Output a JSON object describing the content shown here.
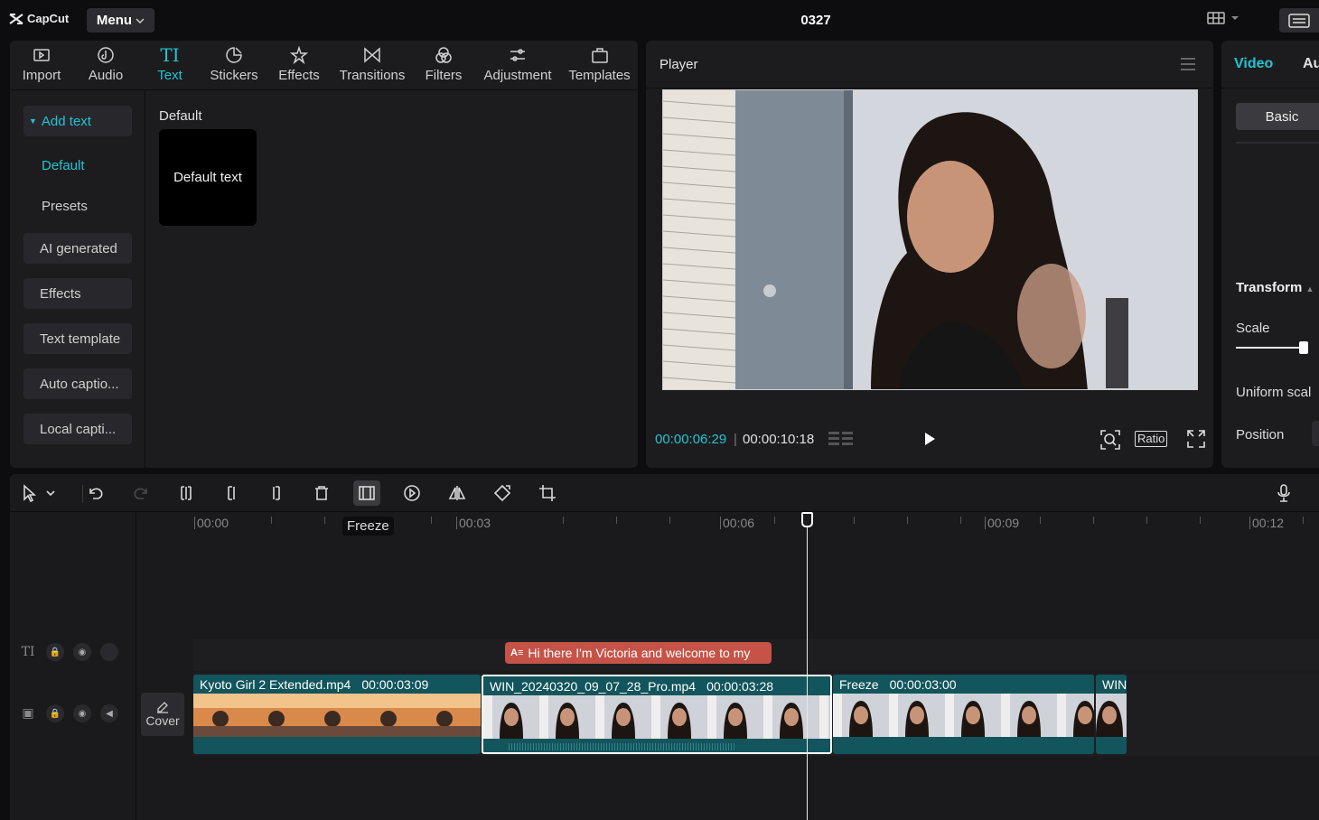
{
  "app": {
    "logo_text": "CapCut",
    "menu_label": "Menu",
    "project_title": "0327"
  },
  "media_tabs": [
    {
      "label": "Import",
      "icon": "import-icon"
    },
    {
      "label": "Audio",
      "icon": "audio-icon"
    },
    {
      "label": "Text",
      "icon": "text-icon",
      "active": true
    },
    {
      "label": "Stickers",
      "icon": "stickers-icon"
    },
    {
      "label": "Effects",
      "icon": "effects-icon"
    },
    {
      "label": "Transitions",
      "icon": "transitions-icon"
    },
    {
      "label": "Filters",
      "icon": "filters-icon"
    },
    {
      "label": "Adjustment",
      "icon": "adjustment-icon"
    },
    {
      "label": "Templates",
      "icon": "templates-icon"
    }
  ],
  "text_nav": {
    "add_text": "Add text",
    "default": "Default",
    "presets": "Presets",
    "ai_generated": "AI generated",
    "effects": "Effects",
    "text_template": "Text template",
    "auto_captions": "Auto captio...",
    "local_captions": "Local capti..."
  },
  "content": {
    "section_title": "Default",
    "card_label": "Default text"
  },
  "player": {
    "title": "Player",
    "current_time": "00:00:06:29",
    "separator": "|",
    "total_time": "00:00:10:18",
    "ratio_label": "Ratio"
  },
  "properties": {
    "tab_video": "Video",
    "tab_audio": "Au",
    "basic_label": "Basic",
    "transform_label": "Transform",
    "scale_label": "Scale",
    "uniform_scale_label": "Uniform scal",
    "position_label": "Position"
  },
  "timeline": {
    "tooltip": "Freeze",
    "ruler_labels": [
      "00:00",
      "00:03",
      "00:06",
      "00:09",
      "00:12"
    ],
    "cover_label": "Cover",
    "text_clip": "Hi there I'm Victoria and welcome to my",
    "clips": [
      {
        "name": "Kyoto Girl 2 Extended.mp4",
        "duration": "00:00:03:09"
      },
      {
        "name": "WIN_20240320_09_07_28_Pro.mp4",
        "duration": "00:00:03:28"
      },
      {
        "name": "Freeze",
        "duration": "00:00:03:00"
      },
      {
        "name": "WIN",
        "duration": ""
      }
    ]
  },
  "colors": {
    "accent": "#22c3d3",
    "text_clip": "#c65348",
    "video_clip": "#12555c"
  }
}
